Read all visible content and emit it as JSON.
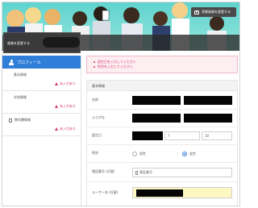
{
  "header": {
    "cover_button_label": "背景画像を変更する",
    "avatar_change_label": "画像を変更する"
  },
  "sidebar": {
    "title": "プロフィール",
    "items": [
      {
        "label": "基本情報",
        "status": "未入力あり"
      },
      {
        "label": "学校情報",
        "status": "未入力あり"
      },
      {
        "label": "教科書情報",
        "status": "未入力あり"
      }
    ]
  },
  "alerts": [
    "誕生日を入力してください",
    "性別を入力してください"
  ],
  "form": {
    "title": "基本情報",
    "name_label": "名前",
    "kana_label": "ふりがな",
    "birthday_label": "誕生日",
    "birthday_month": "7",
    "birthday_day": "30",
    "gender_label": "性別",
    "gender_options": [
      "男性",
      "女性"
    ],
    "gender_selected": "女性",
    "phone_label": "電話番号 (任意)",
    "phone_placeholder": "電話番号",
    "username_label": "ユーザー名 (任意)"
  },
  "colors": {
    "banner": "#6fd8d2",
    "accent": "#2f7fd8",
    "warning": "#d2366a",
    "highlight_field": "#fdf8c2"
  }
}
